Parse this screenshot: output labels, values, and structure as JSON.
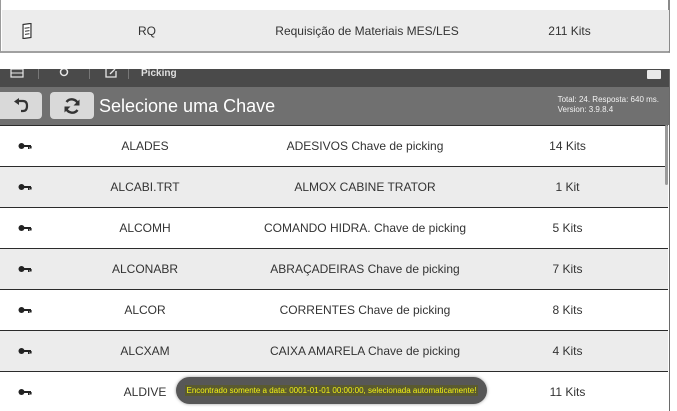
{
  "top_row": {
    "icon": "document-icon",
    "code": "RQ",
    "description": "Requisição de Materiais MES/LES",
    "quantity": "211 Kits"
  },
  "app": {
    "topbar_title": "Picking",
    "title": "Selecione uma Chave",
    "info_line1": "Total: 24. Resposta: 640 ms.",
    "info_line2": "Version: 3.9.8.4"
  },
  "rows": [
    {
      "icon": "key-icon",
      "code": "ALADES",
      "description": "ADESIVOS Chave de picking",
      "quantity": "14 Kits"
    },
    {
      "icon": "key-icon",
      "code": "ALCABI.TRT",
      "description": "ALMOX CABINE TRATOR",
      "quantity": "1 Kit"
    },
    {
      "icon": "key-icon",
      "code": "ALCOMH",
      "description": "COMANDO HIDRA. Chave de picking",
      "quantity": "5 Kits"
    },
    {
      "icon": "key-icon",
      "code": "ALCONABR",
      "description": "ABRAÇADEIRAS Chave de picking",
      "quantity": "7 Kits"
    },
    {
      "icon": "key-icon",
      "code": "ALCOR",
      "description": "CORRENTES Chave de picking",
      "quantity": "8 Kits"
    },
    {
      "icon": "key-icon",
      "code": "ALCXAM",
      "description": "CAIXA AMARELA Chave de picking",
      "quantity": "4 Kits"
    },
    {
      "icon": "key-icon",
      "code": "ALDIVE",
      "description": "",
      "quantity": "11 Kits"
    }
  ],
  "toast": {
    "message": "Encontrado somente a data: 0001-01-01 00:00:00, selecionada automaticamente!"
  },
  "colors": {
    "header_bg": "#707070",
    "topbar_bg": "#4a4a4a",
    "row_alt_bg": "#ececec",
    "toast_text": "#f2f213"
  }
}
